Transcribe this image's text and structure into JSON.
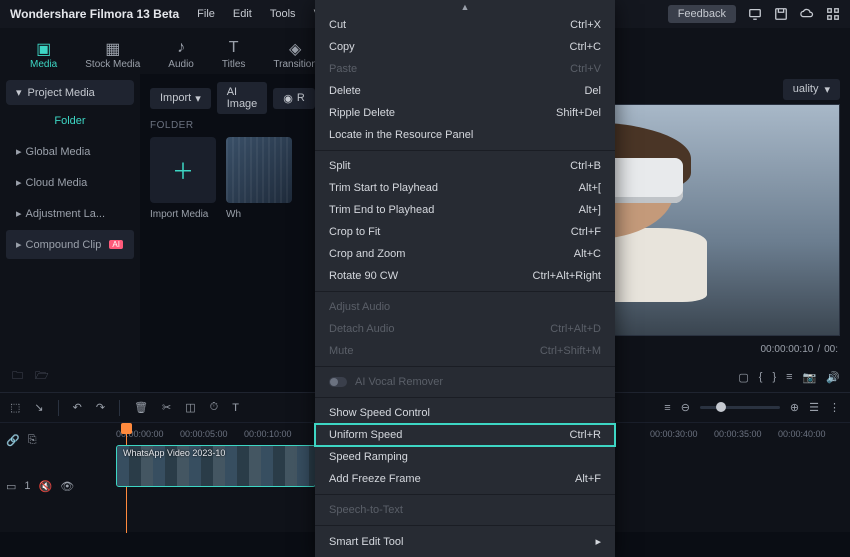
{
  "app_title": "Wondershare Filmora 13 Beta",
  "menubar": [
    "File",
    "Edit",
    "Tools",
    "Vi"
  ],
  "feedback": "Feedback",
  "tools": [
    {
      "label": "Media",
      "active": true
    },
    {
      "label": "Stock Media"
    },
    {
      "label": "Audio"
    },
    {
      "label": "Titles"
    },
    {
      "label": "Transition"
    }
  ],
  "sidebar": {
    "header": "Project Media",
    "folder": "Folder",
    "items": [
      "Global Media",
      "Cloud Media",
      "Adjustment La...",
      "Compound Clip"
    ]
  },
  "browser": {
    "import": "Import",
    "ai_image": "AI Image",
    "rec": "R",
    "folder_label": "FOLDER",
    "thumbs": [
      {
        "label": "Import Media",
        "kind": "add"
      },
      {
        "label": "Wh",
        "kind": "video"
      }
    ]
  },
  "preview": {
    "quality": "uality",
    "time_current": "00:00:00:10",
    "time_total": "00:"
  },
  "ruler": [
    "00:00:00:00",
    "00:00:05:00",
    "00:00:10:00",
    "00:00:30:00",
    "00:00:35:00",
    "00:00:40:00"
  ],
  "clip_label": "WhatsApp Video 2023-10",
  "track_label": "1",
  "context_menu": {
    "groups": [
      [
        {
          "label": "Cut",
          "shortcut": "Ctrl+X"
        },
        {
          "label": "Copy",
          "shortcut": "Ctrl+C"
        },
        {
          "label": "Paste",
          "shortcut": "Ctrl+V",
          "disabled": true
        },
        {
          "label": "Delete",
          "shortcut": "Del"
        },
        {
          "label": "Ripple Delete",
          "shortcut": "Shift+Del"
        },
        {
          "label": "Locate in the Resource Panel"
        }
      ],
      [
        {
          "label": "Split",
          "shortcut": "Ctrl+B"
        },
        {
          "label": "Trim Start to Playhead",
          "shortcut": "Alt+["
        },
        {
          "label": "Trim End to Playhead",
          "shortcut": "Alt+]"
        },
        {
          "label": "Crop to Fit",
          "shortcut": "Ctrl+F"
        },
        {
          "label": "Crop and Zoom",
          "shortcut": "Alt+C"
        },
        {
          "label": "Rotate 90 CW",
          "shortcut": "Ctrl+Alt+Right"
        }
      ],
      [
        {
          "label": "Adjust Audio",
          "disabled": true
        },
        {
          "label": "Detach Audio",
          "shortcut": "Ctrl+Alt+D",
          "disabled": true
        },
        {
          "label": "Mute",
          "shortcut": "Ctrl+Shift+M",
          "disabled": true
        }
      ],
      [
        {
          "label": "AI Vocal Remover",
          "disabled": true,
          "toggle": true
        }
      ],
      [
        {
          "label": "Show Speed Control"
        },
        {
          "label": "Uniform Speed",
          "shortcut": "Ctrl+R",
          "highlight": true
        },
        {
          "label": "Speed Ramping"
        },
        {
          "label": "Add Freeze Frame",
          "shortcut": "Alt+F"
        }
      ],
      [
        {
          "label": "Speech-to-Text",
          "disabled": true
        }
      ],
      [
        {
          "label": "Smart Edit Tool",
          "submenu": true
        }
      ]
    ]
  }
}
